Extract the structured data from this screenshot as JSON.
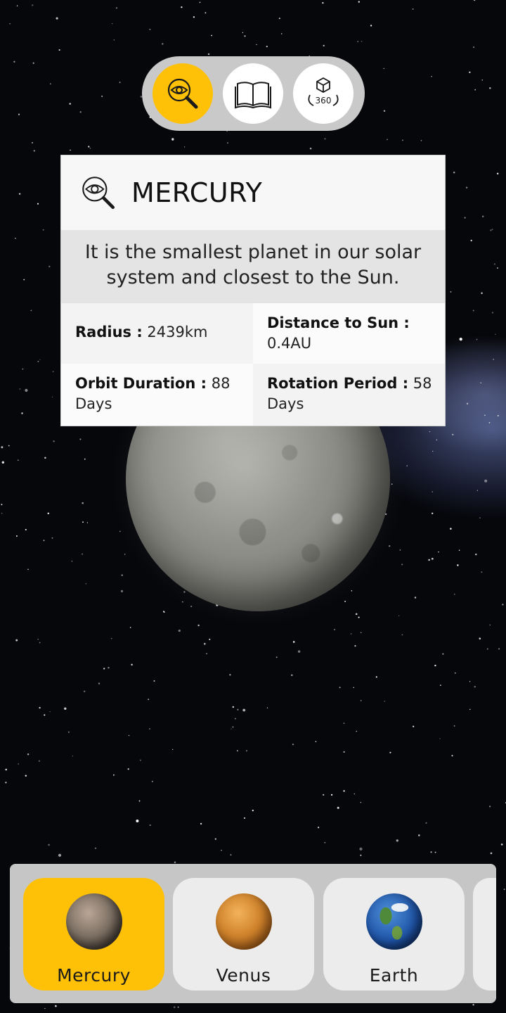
{
  "toolbar": {
    "buttons": [
      {
        "icon": "explore-eye-search-icon",
        "active": true
      },
      {
        "icon": "book-icon",
        "active": false
      },
      {
        "icon": "360-view-icon",
        "active": false,
        "label": "360"
      }
    ],
    "accent_color": "#ffc107"
  },
  "card": {
    "title": "MERCURY",
    "description": "It is the smallest planet in our solar system and closest to the Sun.",
    "facts": [
      {
        "label": "Radius :",
        "value": " 2439km"
      },
      {
        "label": "Distance to Sun :",
        "value": " 0.4AU"
      },
      {
        "label": "Orbit Duration :",
        "value": " 88 Days"
      },
      {
        "label": "Rotation Period :",
        "value": " 58 Days"
      }
    ]
  },
  "planets": [
    {
      "name": "Mercury",
      "active": true
    },
    {
      "name": "Venus",
      "active": false
    },
    {
      "name": "Earth",
      "active": false
    }
  ]
}
